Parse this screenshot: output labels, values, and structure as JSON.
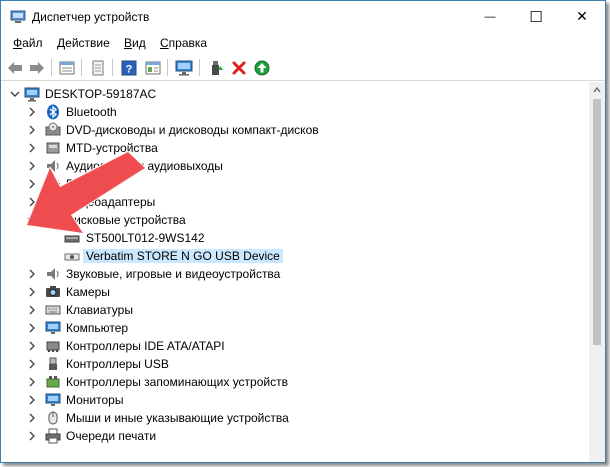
{
  "window": {
    "title": "Диспетчер устройств",
    "minimize_glyph": "—",
    "maximize_glyph": "☐",
    "close_glyph": "✕"
  },
  "menu": {
    "items": [
      {
        "hot": "Ф",
        "rest": "айл"
      },
      {
        "hot": "Д",
        "rest": "ействие"
      },
      {
        "hot": "В",
        "rest": "ид"
      },
      {
        "hot": "С",
        "rest": "правка"
      }
    ]
  },
  "toolbar": {
    "icons": [
      "back-arrow-icon",
      "forward-arrow-icon",
      "properties-list-icon",
      "document-icon",
      "help-icon",
      "details-icon",
      "monitor-scan-icon",
      "update-driver-icon",
      "uninstall-x-icon",
      "enable-device-icon"
    ]
  },
  "tree": {
    "root": "DESKTOP-59187AC",
    "categories": [
      {
        "label": "Bluetooth",
        "icon": "bluetooth-icon",
        "expanded": false
      },
      {
        "label": "DVD-дисководы и дисководы компакт-дисков",
        "icon": "dvd-drive-icon",
        "expanded": false
      },
      {
        "label": "MTD-устройства",
        "icon": "mtd-device-icon",
        "expanded": false
      },
      {
        "label": "Аудиовходы и аудиовыходы",
        "icon": "audio-io-icon",
        "expanded": false
      },
      {
        "label": "Батареи",
        "icon": "battery-icon",
        "expanded": false
      },
      {
        "label": "Видеоадаптеры",
        "icon": "display-adapter-icon",
        "expanded": false
      },
      {
        "label": "Дисковые устройства",
        "icon": "disk-drive-icon",
        "expanded": true,
        "children": [
          {
            "label": "ST500LT012-9WS142",
            "icon": "hard-disk-icon",
            "selected": false
          },
          {
            "label": "Verbatim STORE N GO USB Device",
            "icon": "usb-disk-icon",
            "selected": true
          }
        ]
      },
      {
        "label": "Звуковые, игровые и видеоустройства",
        "icon": "speaker-icon",
        "expanded": false
      },
      {
        "label": "Камеры",
        "icon": "camera-icon",
        "expanded": false
      },
      {
        "label": "Клавиатуры",
        "icon": "keyboard-icon",
        "expanded": false
      },
      {
        "label": "Компьютер",
        "icon": "computer-icon",
        "expanded": false
      },
      {
        "label": "Контроллеры IDE ATA/ATAPI",
        "icon": "ide-controller-icon",
        "expanded": false
      },
      {
        "label": "Контроллеры USB",
        "icon": "usb-controller-icon",
        "expanded": false
      },
      {
        "label": "Контроллеры запоминающих устройств",
        "icon": "storage-controller-icon",
        "expanded": false
      },
      {
        "label": "Мониторы",
        "icon": "monitor-icon",
        "expanded": false
      },
      {
        "label": "Мыши и иные указывающие устройства",
        "icon": "mouse-icon",
        "expanded": false
      },
      {
        "label": "Очереди печати",
        "icon": "print-queue-icon",
        "expanded": false
      }
    ]
  },
  "colors": {
    "selection": "#cce8ff",
    "annotation_arrow": "#ee4c4f",
    "window_border": "#3c7fb1"
  }
}
